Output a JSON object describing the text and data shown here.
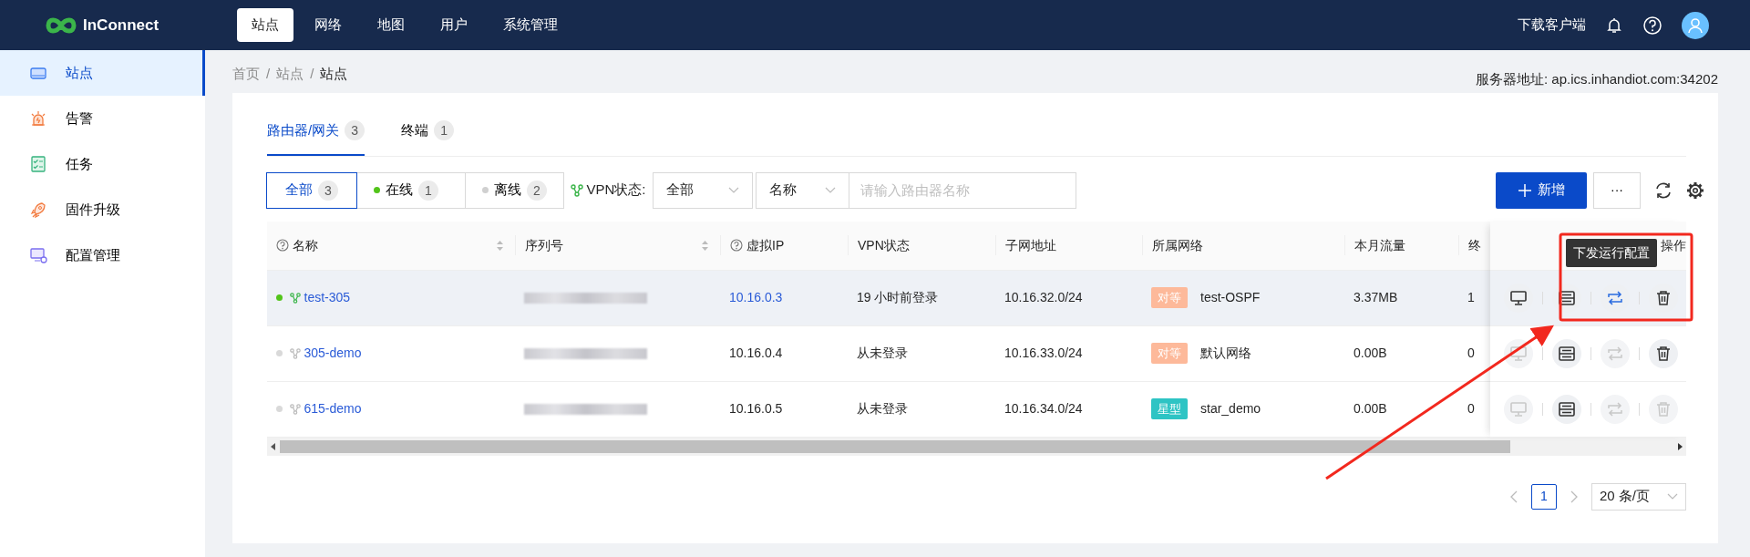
{
  "header": {
    "logo": "InConnect",
    "nav": [
      {
        "label": "站点",
        "selected": true
      },
      {
        "label": "网络",
        "selected": false
      },
      {
        "label": "地图",
        "selected": false
      },
      {
        "label": "用户",
        "selected": false
      },
      {
        "label": "系统管理",
        "selected": false
      }
    ],
    "download": "下载客户端"
  },
  "sidebar": {
    "items": [
      {
        "label": "站点",
        "kind": "device",
        "selected": true
      },
      {
        "label": "告警",
        "kind": "alarm",
        "selected": false
      },
      {
        "label": "任务",
        "kind": "task",
        "selected": false
      },
      {
        "label": "固件升级",
        "kind": "rocket",
        "selected": false
      },
      {
        "label": "配置管理",
        "kind": "config",
        "selected": false
      }
    ]
  },
  "breadcrumb": {
    "separator": "/",
    "items": [
      "首页",
      "站点",
      "站点"
    ]
  },
  "server_address": "服务器地址: ap.ics.inhandiot.com:34202",
  "tabs": [
    {
      "label": "路由器/网关",
      "count": "3",
      "selected": true
    },
    {
      "label": "终端",
      "count": "1",
      "selected": false
    }
  ],
  "status_filter": [
    {
      "label": "全部",
      "count": "3",
      "kind": "all",
      "selected": true
    },
    {
      "label": "在线",
      "count": "1",
      "kind": "online",
      "selected": false
    },
    {
      "label": "离线",
      "count": "2",
      "kind": "offline",
      "selected": false
    }
  ],
  "vpn_filter": {
    "label": "VPN状态:",
    "value": "全部"
  },
  "search": {
    "field": "名称",
    "placeholder": "请输入路由器名称"
  },
  "toolbar": {
    "add": "新增",
    "more": "···"
  },
  "table": {
    "columns": [
      {
        "label": "名称",
        "help": true,
        "sortable": true
      },
      {
        "label": "序列号",
        "help": false,
        "sortable": true
      },
      {
        "label": "虚拟IP",
        "help": true,
        "sortable": false
      },
      {
        "label": "VPN状态",
        "help": false,
        "sortable": false
      },
      {
        "label": "子网地址",
        "help": false,
        "sortable": false
      },
      {
        "label": "所属网络",
        "help": false,
        "sortable": false
      },
      {
        "label": "本月流量",
        "help": false,
        "sortable": false
      },
      {
        "label": "终",
        "help": false,
        "sortable": false
      },
      {
        "label": "操作",
        "help": false,
        "sortable": false
      }
    ],
    "rows": [
      {
        "online": true,
        "hovered": true,
        "name": "test-305",
        "virtual_ip": "10.16.0.3",
        "ip_link": true,
        "vpn_status": "19 小时前登录",
        "subnet": "10.16.32.0/24",
        "network_type": {
          "label": "对等",
          "color": "#fdb99a"
        },
        "network": "test-OSPF",
        "traffic": "3.37MB",
        "terminals": "1",
        "actions": [
          {
            "kind": "monitor",
            "disabled": false,
            "active": false
          },
          {
            "kind": "config",
            "disabled": false,
            "active": false
          },
          {
            "kind": "sync",
            "disabled": false,
            "active": true,
            "tooltip": "下发运行配置"
          },
          {
            "kind": "delete",
            "disabled": false,
            "active": false
          }
        ]
      },
      {
        "online": false,
        "hovered": false,
        "name": "305-demo",
        "virtual_ip": "10.16.0.4",
        "ip_link": false,
        "vpn_status": "从未登录",
        "subnet": "10.16.33.0/24",
        "network_type": {
          "label": "对等",
          "color": "#fdb99a"
        },
        "network": "默认网络",
        "traffic": "0.00B",
        "terminals": "0",
        "actions": [
          {
            "kind": "monitor",
            "disabled": true,
            "active": false
          },
          {
            "kind": "config",
            "disabled": false,
            "active": false
          },
          {
            "kind": "sync",
            "disabled": true,
            "active": false
          },
          {
            "kind": "delete",
            "disabled": false,
            "active": false
          }
        ]
      },
      {
        "online": false,
        "hovered": false,
        "name": "615-demo",
        "virtual_ip": "10.16.0.5",
        "ip_link": false,
        "vpn_status": "从未登录",
        "subnet": "10.16.34.0/24",
        "network_type": {
          "label": "星型",
          "color": "#2ec4c4"
        },
        "network": "star_demo",
        "traffic": "0.00B",
        "terminals": "0",
        "actions": [
          {
            "kind": "monitor",
            "disabled": true,
            "active": false
          },
          {
            "kind": "config",
            "disabled": false,
            "active": false
          },
          {
            "kind": "sync",
            "disabled": true,
            "active": false
          },
          {
            "kind": "delete",
            "disabled": true,
            "active": false
          }
        ]
      }
    ]
  },
  "pagination": {
    "pages": [
      {
        "label": "1",
        "selected": true
      }
    ],
    "page_size": "20 条/页"
  }
}
